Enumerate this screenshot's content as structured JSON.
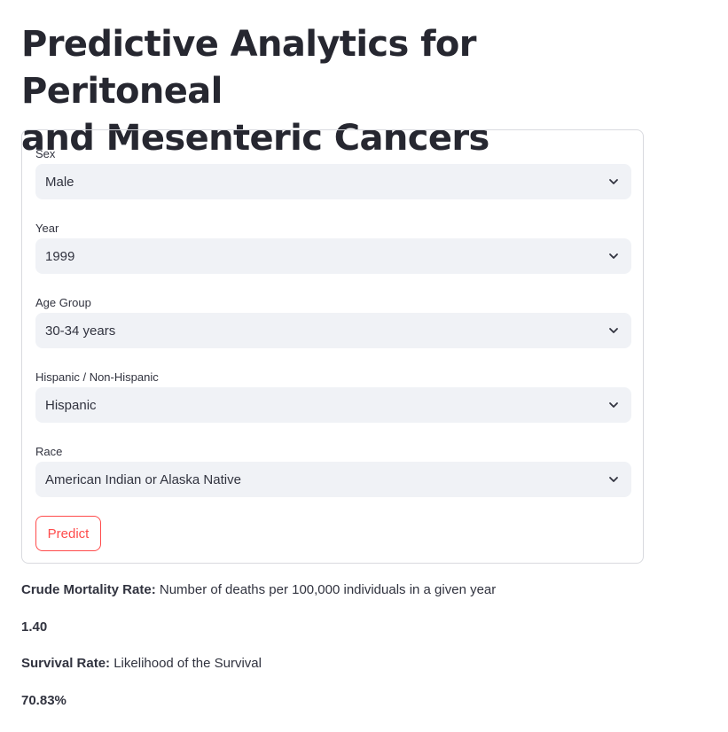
{
  "header": {
    "title_line1": "Predictive Analytics for Peritoneal",
    "title_line2": "and Mesenteric Cancers"
  },
  "form": {
    "fields": [
      {
        "label": "Sex",
        "value": "Male"
      },
      {
        "label": "Year",
        "value": "1999"
      },
      {
        "label": "Age Group",
        "value": "30-34 years"
      },
      {
        "label": "Hispanic / Non-Hispanic",
        "value": "Hispanic"
      },
      {
        "label": "Race",
        "value": "American Indian or Alaska Native"
      }
    ],
    "predict_label": "Predict"
  },
  "results": {
    "crude_mortality_label": "Crude Mortality Rate:",
    "crude_mortality_desc": " Number of deaths per 100,000 individuals in a given year",
    "crude_mortality_value": "1.40",
    "survival_label": "Survival Rate:",
    "survival_desc": " Likelihood of the Survival",
    "survival_value": "70.83%"
  },
  "colors": {
    "accent": "#ff4b4b",
    "select_bg": "#f0f2f6",
    "text": "#31333f"
  },
  "icons": {
    "select_chevron": "chevron-down-icon"
  }
}
